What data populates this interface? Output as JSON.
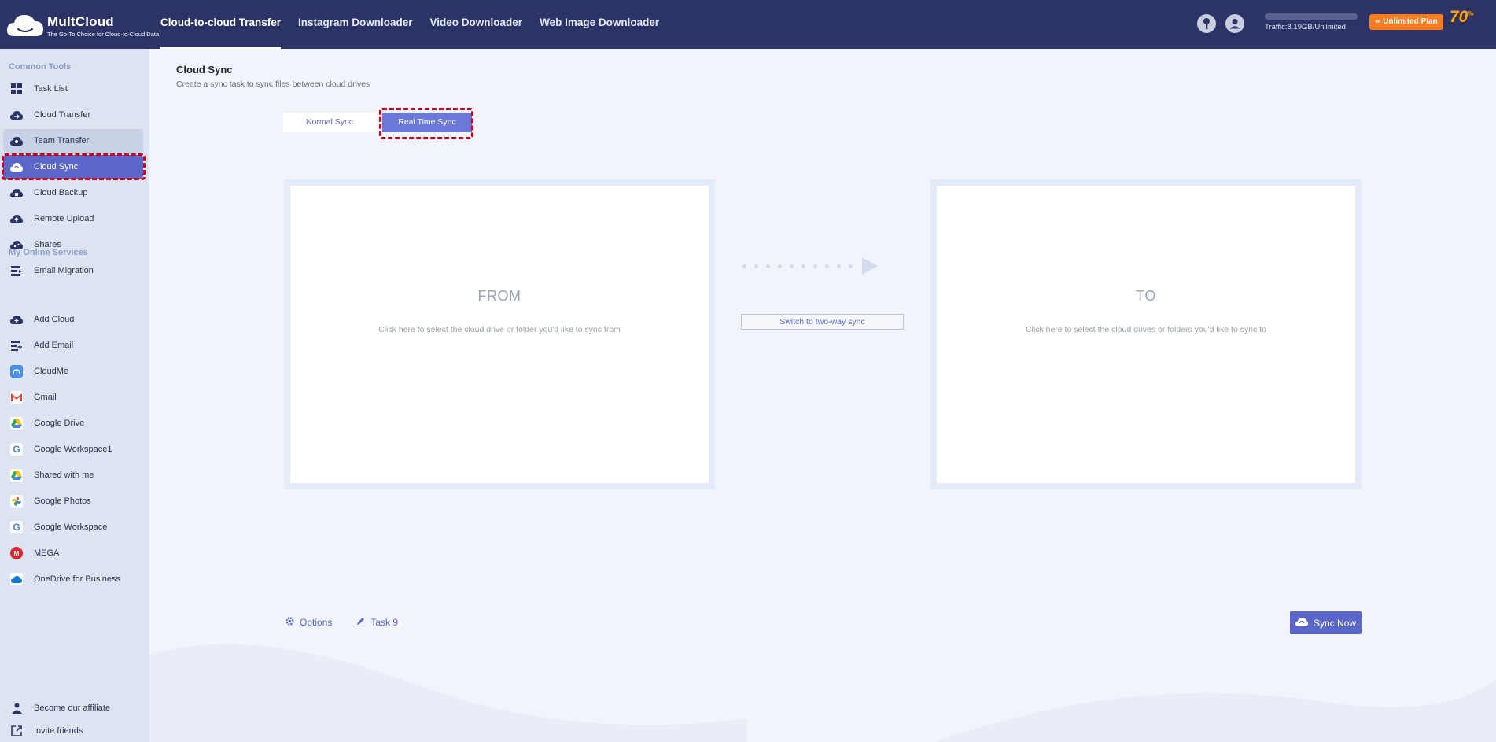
{
  "header": {
    "logo_name": "MultCloud",
    "logo_tagline": "The Go-To Choice for Cloud-to-Cloud Data",
    "nav": [
      {
        "label": "Cloud-to-cloud Transfer",
        "active": true
      },
      {
        "label": "Instagram Downloader",
        "active": false
      },
      {
        "label": "Video Downloader",
        "active": false
      },
      {
        "label": "Web Image Downloader",
        "active": false
      }
    ],
    "traffic": "Traffic:8.19GB/Unlimited",
    "plan_label": "Unlimited Plan",
    "promo": "70",
    "promo_suffix": "%"
  },
  "sidebar": {
    "common_tools_heading": "Common Tools",
    "common_tools": [
      {
        "label": "Task List",
        "icon": "grid-icon"
      },
      {
        "label": "Cloud Transfer",
        "icon": "cloud-transfer-icon"
      },
      {
        "label": "Team Transfer",
        "icon": "team-transfer-icon"
      },
      {
        "label": "Cloud Sync",
        "icon": "cloud-sync-icon"
      },
      {
        "label": "Cloud Backup",
        "icon": "cloud-backup-icon"
      },
      {
        "label": "Remote Upload",
        "icon": "remote-upload-icon"
      },
      {
        "label": "Shares",
        "icon": "shares-icon"
      },
      {
        "label": "Email Migration",
        "icon": "email-migration-icon"
      }
    ],
    "services_heading": "My Online Services",
    "services": [
      {
        "label": "Add Cloud",
        "icon": "add-cloud-icon"
      },
      {
        "label": "Add Email",
        "icon": "add-email-icon"
      },
      {
        "label": "CloudMe",
        "icon": "cloudme-icon"
      },
      {
        "label": "Gmail",
        "icon": "gmail-icon"
      },
      {
        "label": "Google Drive",
        "icon": "google-drive-icon"
      },
      {
        "label": "Google Workspace1",
        "icon": "google-workspace-icon"
      },
      {
        "label": "Shared with me",
        "icon": "google-drive-icon"
      },
      {
        "label": "Google Photos",
        "icon": "google-photos-icon"
      },
      {
        "label": "Google Workspace",
        "icon": "google-workspace-icon"
      },
      {
        "label": "MEGA",
        "icon": "mega-icon"
      },
      {
        "label": "OneDrive for Business",
        "icon": "onedrive-icon"
      }
    ],
    "bottom": [
      {
        "label": "Become our affiliate",
        "icon": "affiliate-icon"
      },
      {
        "label": "Invite friends",
        "icon": "invite-icon"
      }
    ]
  },
  "main": {
    "title": "Cloud Sync",
    "subtitle": "Create a sync task to sync files between cloud drives",
    "tabs": {
      "normal": "Normal Sync",
      "realtime": "Real Time Sync",
      "selected": "Real Time Sync"
    },
    "from": {
      "title": "FROM",
      "hint": "Click here to select the cloud drive or folder you'd like to sync from"
    },
    "to": {
      "title": "TO",
      "hint": "Click here to select the cloud drives or folders you'd like to sync to"
    },
    "switch_label": "Switch to two-way sync",
    "options_label": "Options",
    "task_label": "Task 9",
    "sync_now_label": "Sync Now"
  },
  "colors": {
    "header_bg": "#2c3367",
    "accent": "#5a67c8",
    "plan_orange": "#f57c1f",
    "highlight_red": "#d0021b"
  }
}
